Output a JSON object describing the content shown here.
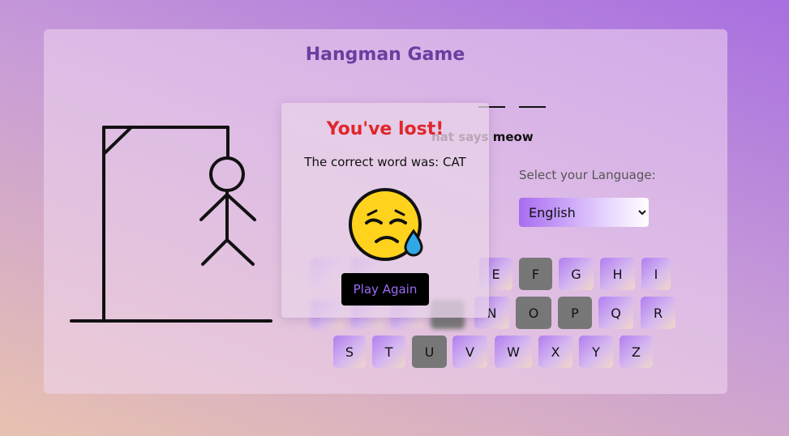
{
  "header": {
    "title": "Hangman Game"
  },
  "word": {
    "blanks_visible": 2
  },
  "hint": {
    "text": "hat says meow"
  },
  "language": {
    "label": "Select your Language:",
    "selected": "English"
  },
  "keyboard": {
    "row2": [
      "E",
      "F",
      "G",
      "H",
      "I"
    ],
    "row3": [
      "N",
      "O",
      "P",
      "Q",
      "R"
    ],
    "row4": [
      "S",
      "T",
      "U",
      "V",
      "W",
      "X",
      "Y",
      "Z"
    ],
    "used_letters": [
      "F",
      "O",
      "P",
      "U"
    ]
  },
  "result_popup": {
    "title": "You've lost!",
    "message": "The correct word was: CAT",
    "emoji": "sad-face-with-sweat-icon",
    "button_label": "Play Again"
  },
  "colors": {
    "title": "#6a3ea0",
    "lost": "#e0262a",
    "button_text": "#9b6cf5",
    "used_key": "#777777"
  }
}
